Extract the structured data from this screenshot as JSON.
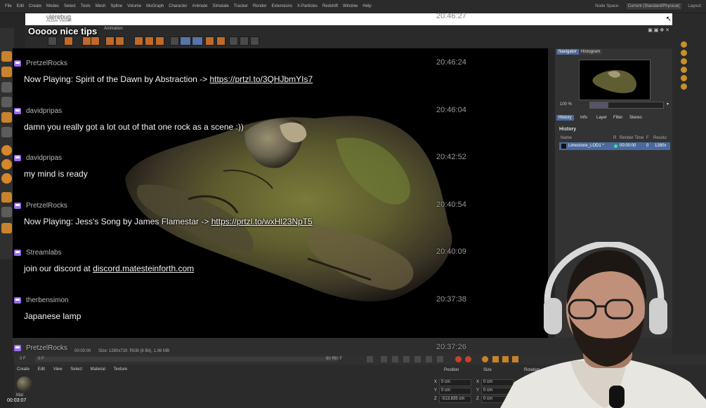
{
  "menubar": {
    "items": [
      "File",
      "Edit",
      "Create",
      "Modes",
      "Select",
      "Tools",
      "Mesh",
      "Spline",
      "Volume",
      "MoGraph",
      "Character",
      "Animate",
      "Simulate",
      "Tracker",
      "Render",
      "Extensions",
      "X-Particles",
      "Redshift",
      "Window",
      "Help"
    ],
    "node_space_label": "Node Space:",
    "node_space_value": "Current (Standard/Physical)",
    "layout_label": "Layout:"
  },
  "picture_viewer": {
    "tabs_label": "Animation",
    "status_frame": "00:00:00",
    "status_size": "Size: 1280x720, RGB (8 Bit), 1.06 MB"
  },
  "navigator": {
    "tabs": [
      "Navigator",
      "Histogram"
    ],
    "zoom_value": "100 %",
    "zoom_fraction": 0.25,
    "info_tabs": [
      "History",
      "Info",
      "Layer",
      "Filter",
      "Stereo"
    ],
    "history_heading": "History",
    "columns": [
      "Name",
      "R",
      "Render Time",
      "F",
      "Resolu"
    ],
    "row": {
      "name": "Limestone_LOD1 *",
      "render_time": "00:00:00",
      "f": "0",
      "res": "1280x"
    }
  },
  "timeline": {
    "start": "0 F",
    "start2": "0 F",
    "end": "90 F",
    "end2": "90 F"
  },
  "material_manager": {
    "menu": [
      "Create",
      "Edit",
      "View",
      "Select",
      "Material",
      "Texture"
    ],
    "material_name": "Mat"
  },
  "coordinates": {
    "headers": [
      "Position",
      "Size",
      "Rotation"
    ],
    "rows": [
      {
        "axis": "X",
        "pos": "0 cm",
        "size_axis": "X",
        "size": "0 cm"
      },
      {
        "axis": "Y",
        "pos": "0 cm",
        "size_axis": "Y",
        "size": "0 cm"
      },
      {
        "axis": "Z",
        "pos": "-513.835 cm",
        "size_axis": "Z",
        "size": "0 cm"
      }
    ]
  },
  "video_timestamp": "00:03:07",
  "chat": {
    "overlay_title": "Ooooo nice tips",
    "header_user": "ulerebug",
    "header_sub": "Active Viewer",
    "header_time": "20:46:27",
    "messages": [
      {
        "user": "PretzelRocks",
        "time": "20:46:24",
        "text": "Now Playing: Spirit of the Dawn by Abstraction -> ",
        "link": "https://prtzl.to/3QHJbmYIs7"
      },
      {
        "user": "davidpripas",
        "time": "20:46:04",
        "text": "damn you really got a lot out of that one rock as a scene :))",
        "link": ""
      },
      {
        "user": "davidpripas",
        "time": "20:42:52",
        "text": "my mind is ready",
        "link": ""
      },
      {
        "user": "PretzelRocks",
        "time": "20:40:54",
        "text": "Now Playing: Jess's Song by James Flamestar -> ",
        "link": "https://prtzl.to/wxHl23NpT5"
      },
      {
        "user": "Streamlabs",
        "time": "20:40:09",
        "text": "join our discord at ",
        "link": "discord.matesteinforth.com"
      },
      {
        "user": "therbensimon",
        "time": "20:37:38",
        "text": "Japanese lamp",
        "link": ""
      },
      {
        "user": "PretzelRocks",
        "time": "20:37:26",
        "text": "",
        "link": ""
      }
    ]
  },
  "colors": {
    "accent_orange": "#c9822d",
    "selection_blue": "#4a6a9e",
    "twitch_purple": "#9b6cf2"
  }
}
